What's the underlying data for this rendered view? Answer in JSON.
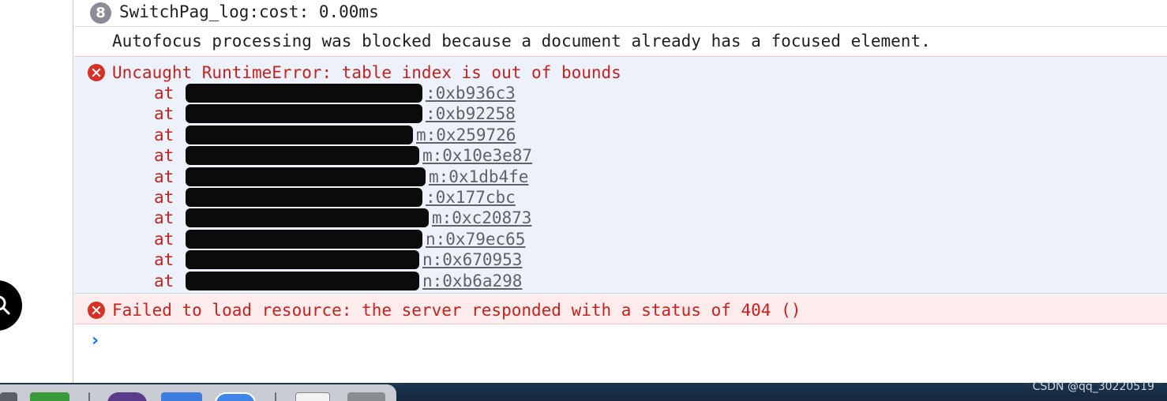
{
  "console": {
    "log": {
      "count_badge": "8",
      "message": "SwitchPag_log:cost: 0.00ms"
    },
    "info": {
      "message": "Autofocus processing was blocked because a document already has a focused element."
    },
    "error": {
      "title": "Uncaught RuntimeError: table index is out of bounds",
      "stack": [
        {
          "prefix": "at",
          "location": ":0xb936c3"
        },
        {
          "prefix": "at",
          "location": ":0xb92258"
        },
        {
          "prefix": "at",
          "location": "m:0x259726"
        },
        {
          "prefix": "at",
          "location": "m:0x10e3e87"
        },
        {
          "prefix": "at",
          "location": "m:0x1db4fe"
        },
        {
          "prefix": "at",
          "location": ":0x177cbc"
        },
        {
          "prefix": "at",
          "location": "m:0xc20873"
        },
        {
          "prefix": "at",
          "location": "n:0x79ec65"
        },
        {
          "prefix": "at",
          "location": "n:0x670953"
        },
        {
          "prefix": "at",
          "location": "n:0xb6a298"
        }
      ]
    },
    "resource_error": {
      "message": "Failed to load resource: the server responded with a status of 404 ()"
    },
    "prompt_symbol": "›"
  },
  "watermark": "CSDN @qq_30220519",
  "colors": {
    "error_text": "#c5221f",
    "error_background": "#edf1fa",
    "resource_error_background": "#fdeceb",
    "link_text": "#5f6368",
    "prompt": "#1a73e8"
  },
  "icons": {
    "error": "error-icon",
    "search": "search-icon"
  }
}
